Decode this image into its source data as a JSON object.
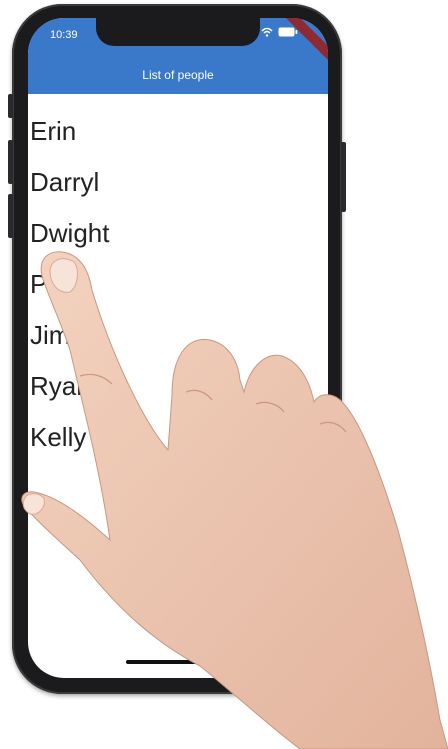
{
  "status_bar": {
    "time": "10:39"
  },
  "app_bar": {
    "title": "List of people",
    "color": "#3a78c9"
  },
  "people": [
    "Erin",
    "Darryl",
    "Dwight",
    "Pam",
    "Jim",
    "Ryan",
    "Kelly"
  ],
  "icons": {
    "wifi": "wifi-icon",
    "battery": "battery-icon"
  }
}
